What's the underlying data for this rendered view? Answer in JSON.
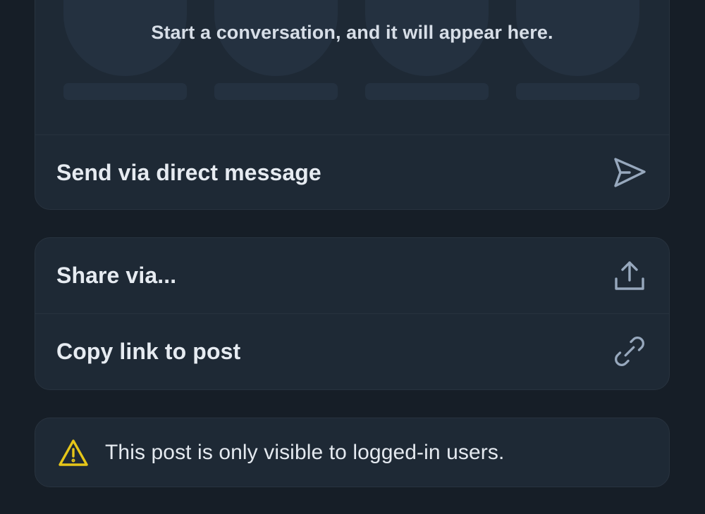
{
  "recent": {
    "empty_text": "Start a conversation, and it will appear here."
  },
  "dm": {
    "label": "Send via direct message",
    "icon": "paper-plane-icon"
  },
  "share": {
    "share_label": "Share via...",
    "share_icon": "share-upload-icon",
    "copy_label": "Copy link to post",
    "copy_icon": "link-icon"
  },
  "notice": {
    "text": "This post is only visible to logged-in users.",
    "icon": "warning-icon",
    "icon_color": "#e6c619"
  },
  "colors": {
    "background": "#161e27",
    "card": "#1e2935",
    "icon": "#97a8bd"
  }
}
